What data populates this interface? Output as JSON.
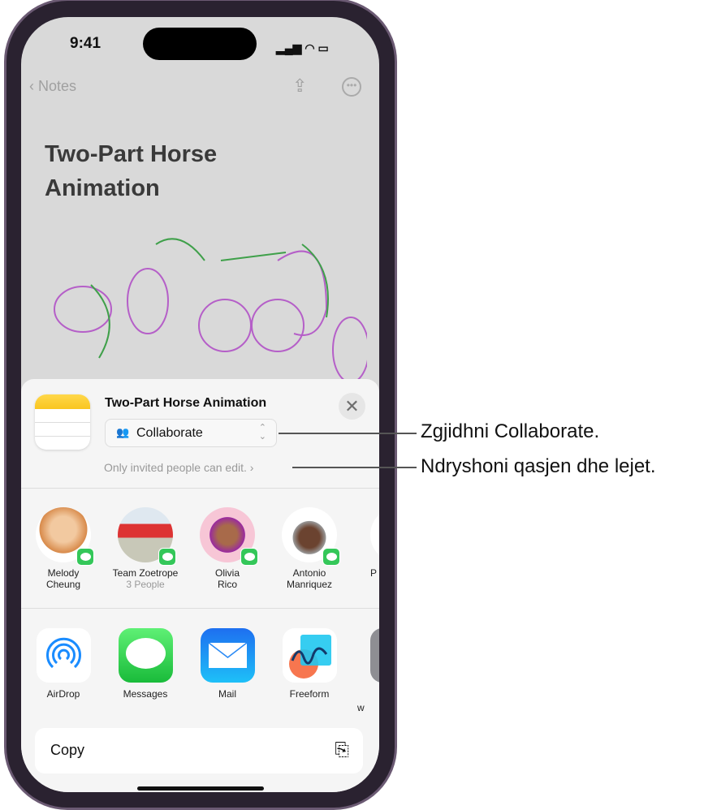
{
  "status_bar": {
    "time": "9:41"
  },
  "nav": {
    "back_label": "Notes"
  },
  "note": {
    "title": "Two-Part Horse Animation"
  },
  "share_sheet": {
    "document_title": "Two-Part Horse Animation",
    "mode_select": "Collaborate",
    "permissions_text": "Only invited people can edit.",
    "people": [
      {
        "name_line1": "Melody",
        "name_line2": "Cheung",
        "sub": ""
      },
      {
        "name_line1": "Team Zoetrope",
        "name_line2": "",
        "sub": "3 People"
      },
      {
        "name_line1": "Olivia",
        "name_line2": "Rico",
        "sub": ""
      },
      {
        "name_line1": "Antonio",
        "name_line2": "Manriquez",
        "sub": ""
      },
      {
        "name_line1": "P",
        "name_line2": "",
        "sub": ""
      }
    ],
    "apps": [
      {
        "label": "AirDrop"
      },
      {
        "label": "Messages"
      },
      {
        "label": "Mail"
      },
      {
        "label": "Freeform"
      },
      {
        "label": "w"
      }
    ],
    "copy_label": "Copy"
  },
  "annotations": {
    "collaborate": "Zgjidhni Collaborate.",
    "permissions": "Ndryshoni qasjen dhe lejet."
  },
  "colors": {
    "messages_green": "#34c759",
    "mail_blue": "#1e8cf5",
    "airdrop_blue": "#1a8cff",
    "notes_yellow": "#f9c620"
  }
}
